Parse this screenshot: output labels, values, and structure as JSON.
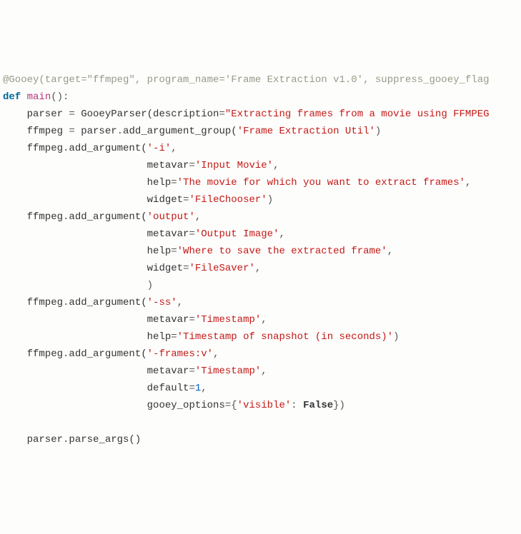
{
  "code": {
    "decorator": "@Gooey(target=\"ffmpeg\", program_name='Frame Extraction v1.0', suppress_gooey_flag",
    "def": "def",
    "main": "main",
    "colon": "():",
    "l3_a": "    parser ",
    "l3_b": "=",
    "l3_c": " GooeyParser(description",
    "l3_d": "=",
    "l3_e": "\"Extracting frames from a movie using FFMPEG",
    "l4_a": "    ffmpeg ",
    "l4_b": "=",
    "l4_c": " parser",
    "l4_d": ".",
    "l4_e": "add_argument_group(",
    "l4_f": "'Frame Extraction Util'",
    "l4_g": ")",
    "l5_a": "    ffmpeg",
    "l5_b": ".",
    "l5_c": "add_argument(",
    "l5_d": "'-i'",
    "l5_e": ",",
    "indent_kwarg": "                        ",
    "l6_a": "metavar",
    "l6_b": "=",
    "l6_c": "'Input Movie'",
    "l6_d": ",",
    "l7_a": "help",
    "l7_b": "=",
    "l7_c": "'The movie for which you want to extract frames'",
    "l7_d": ",",
    "l8_a": "widget",
    "l8_b": "=",
    "l8_c": "'FileChooser'",
    "l8_d": ")",
    "l9_a": "    ffmpeg",
    "l9_b": ".",
    "l9_c": "add_argument(",
    "l9_d": "'output'",
    "l9_e": ",",
    "l10_a": "metavar",
    "l10_b": "=",
    "l10_c": "'Output Image'",
    "l10_d": ",",
    "l11_a": "help",
    "l11_b": "=",
    "l11_c": "'Where to save the extracted frame'",
    "l11_d": ",",
    "l12_a": "widget",
    "l12_b": "=",
    "l12_c": "'FileSaver'",
    "l12_d": ",",
    "l13_a": ")",
    "l14_a": "    ffmpeg",
    "l14_b": ".",
    "l14_c": "add_argument(",
    "l14_d": "'-ss'",
    "l14_e": ",",
    "l15_a": "metavar",
    "l15_b": "=",
    "l15_c": "'Timestamp'",
    "l15_d": ",",
    "l16_a": "help",
    "l16_b": "=",
    "l16_c": "'Timestamp of snapshot (in seconds)'",
    "l16_d": ")",
    "l17_a": "    ffmpeg",
    "l17_b": ".",
    "l17_c": "add_argument(",
    "l17_d": "'-frames:v'",
    "l17_e": ",",
    "l18_a": "metavar",
    "l18_b": "=",
    "l18_c": "'Timestamp'",
    "l18_d": ",",
    "l19_a": "default",
    "l19_b": "=",
    "l19_c": "1",
    "l19_d": ",",
    "l20_a": "gooey_options",
    "l20_b": "=",
    "l20_c": "{",
    "l20_d": "'visible'",
    "l20_e": ": ",
    "l20_f": "False",
    "l20_g": "})",
    "l22_a": "    parser",
    "l22_b": ".",
    "l22_c": "parse_args()"
  }
}
